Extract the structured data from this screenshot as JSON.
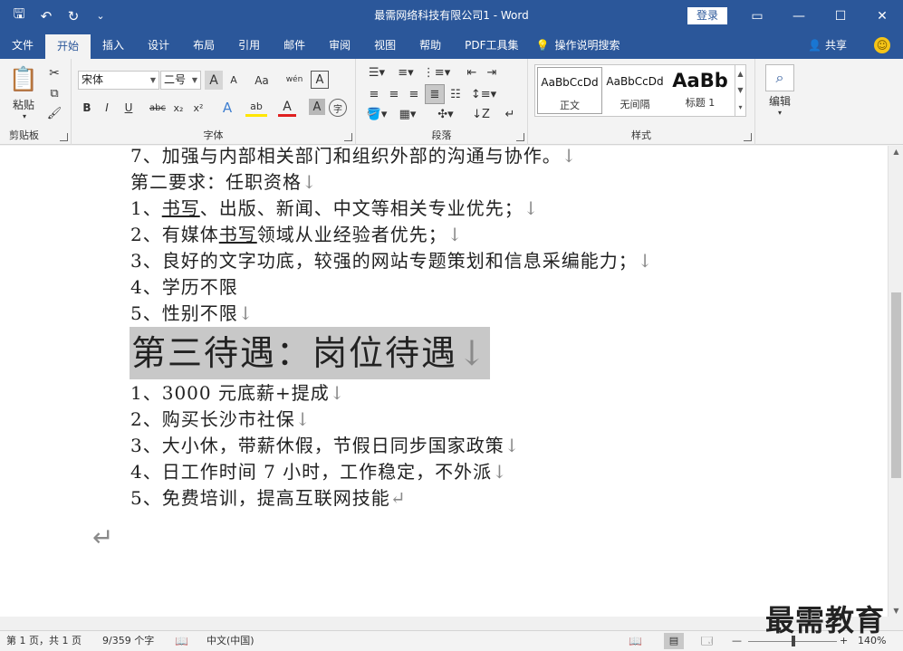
{
  "titlebar": {
    "title": "最需网络科技有限公司1  -  Word",
    "login": "登录",
    "qat": {
      "save": "🖫",
      "undo": "↶",
      "redo": "↻",
      "customize": "⌄"
    },
    "controls": {
      "ribbon_display": "▭",
      "minimize": "—",
      "maximize": "☐",
      "close": "✕"
    }
  },
  "tabs": [
    "文件",
    "开始",
    "插入",
    "设计",
    "布局",
    "引用",
    "邮件",
    "审阅",
    "视图",
    "帮助",
    "PDF工具集"
  ],
  "active_tab": "开始",
  "tell_me": "操作说明搜索",
  "share": "共享",
  "ribbon": {
    "clipboard": {
      "label": "剪贴板",
      "paste": "粘贴"
    },
    "font": {
      "label": "字体",
      "font_name": "宋体",
      "font_size": "二号",
      "grow": "A",
      "shrink": "A",
      "case": "Aa",
      "phonetic": "wén",
      "border": "A",
      "bold": "B",
      "italic": "I",
      "underline": "U",
      "strike": "abc",
      "subscript": "x₂",
      "superscript": "x²",
      "effects": "A",
      "highlight": "ab",
      "font_color": "A",
      "shading": "A",
      "enclose": "字"
    },
    "paragraph": {
      "label": "段落"
    },
    "styles": {
      "label": "样式",
      "items": [
        {
          "sample": "AaBbCcDd",
          "name": "正文"
        },
        {
          "sample": "AaBbCcDd",
          "name": "无间隔"
        },
        {
          "sample": "AaBb",
          "name": "标题 1"
        }
      ]
    },
    "editing": {
      "label": "编辑"
    }
  },
  "document": {
    "lines": [
      "7、加强与内部相关部门和组织外部的沟通与协作。",
      "第二要求：任职资格",
      "1、书写、出版、新闻、中文等相关专业优先；",
      "2、有媒体书写领域从业经验者优先；",
      "3、良好的文字功底，较强的网站专题策划和信息采编能力；",
      "4、学历不限",
      "5、性别不限"
    ],
    "line1_parts": [
      "1、",
      "书写",
      "、出版、新闻、中文等相关专业优先；"
    ],
    "line2_parts": [
      "2、有媒体",
      "书写",
      "领域从业经验者优先；"
    ],
    "heading": "第三待遇：岗位待遇",
    "benefits": [
      "1、3000 元底薪+提成",
      "2、购买长沙市社保",
      "3、大小休，带薪休假，节假日同步国家政策",
      "4、日工作时间 7 小时，工作稳定，不外派",
      "5、免费培训，提高互联网技能"
    ],
    "line_break_mark": "↓",
    "para_mark": "↵"
  },
  "statusbar": {
    "page": "第 1 页，共 1 页",
    "words": "9/359 个字",
    "language": "中文(中国)",
    "zoom": "140%",
    "zoom_minus": "—",
    "zoom_plus": "+"
  },
  "watermark": "最需教育"
}
